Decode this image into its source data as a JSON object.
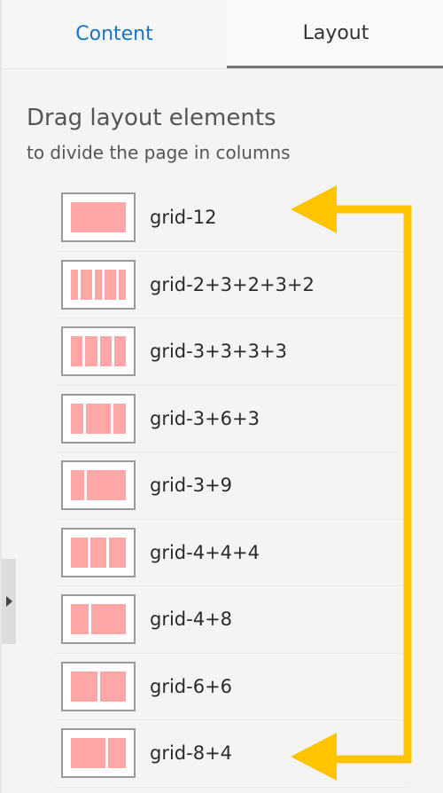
{
  "tabs": {
    "content_label": "Content",
    "layout_label": "Layout",
    "active": "Layout"
  },
  "header": {
    "title": "Drag layout elements",
    "subtitle": "to divide the page in columns"
  },
  "layout_items": [
    {
      "label": "grid-12",
      "columns": [
        12
      ]
    },
    {
      "label": "grid-2+3+2+3+2",
      "columns": [
        2,
        3,
        2,
        3,
        2
      ]
    },
    {
      "label": "grid-3+3+3+3",
      "columns": [
        3,
        3,
        3,
        3
      ]
    },
    {
      "label": "grid-3+6+3",
      "columns": [
        3,
        6,
        3
      ]
    },
    {
      "label": "grid-3+9",
      "columns": [
        3,
        9
      ]
    },
    {
      "label": "grid-4+4+4",
      "columns": [
        4,
        4,
        4
      ]
    },
    {
      "label": "grid-4+8",
      "columns": [
        4,
        8
      ]
    },
    {
      "label": "grid-6+6",
      "columns": [
        6,
        6
      ]
    },
    {
      "label": "grid-8+4",
      "columns": [
        8,
        4
      ]
    }
  ],
  "colors": {
    "accent_tab": "#1a73c7",
    "column_fill": "#ffa6a6",
    "annotation_arrow": "#ffc400"
  },
  "icons": {
    "collapse_handle": "caret-right-icon"
  }
}
